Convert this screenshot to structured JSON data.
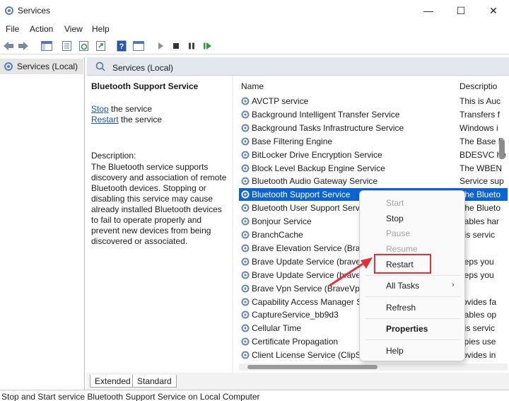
{
  "window": {
    "title": "Services",
    "minimize": "—",
    "maximize": "☐",
    "close": "✕"
  },
  "menu": [
    "File",
    "Action",
    "View",
    "Help"
  ],
  "toolbar": [
    "back-icon",
    "forward-icon",
    "console-tree-icon",
    "properties-icon",
    "refresh-icon",
    "export-icon",
    "help-icon",
    "view-icon",
    "start-icon",
    "stop-icon",
    "pause-icon",
    "restart-icon"
  ],
  "tree": {
    "label": "Services (Local)"
  },
  "right_header": {
    "label": "Services (Local)"
  },
  "details": {
    "title": "Bluetooth Support Service",
    "stop_link": "Stop",
    "stop_suffix": " the service",
    "restart_link": "Restart",
    "restart_suffix": " the service",
    "description_label": "Description:",
    "description": "The Bluetooth service supports discovery and association of remote Bluetooth devices.  Stopping or disabling this service may cause already installed Bluetooth devices to fail to operate properly and prevent new devices from being discovered or associated."
  },
  "columns": {
    "name": "Name",
    "description": "Descriptio"
  },
  "services": [
    {
      "name": "AVCTP service",
      "desc": "This is Auc"
    },
    {
      "name": "Background Intelligent Transfer Service",
      "desc": "Transfers f"
    },
    {
      "name": "Background Tasks Infrastructure Service",
      "desc": "Windows i"
    },
    {
      "name": "Base Filtering Engine",
      "desc": "The Base F"
    },
    {
      "name": "BitLocker Drive Encryption Service",
      "desc": "BDESVC he"
    },
    {
      "name": "Block Level Backup Engine Service",
      "desc": "The WBEN"
    },
    {
      "name": "Bluetooth Audio Gateway Service",
      "desc": "Service sup"
    },
    {
      "name": "Bluetooth Support Service",
      "desc": "The Blueto"
    },
    {
      "name": "Bluetooth User Support Servic",
      "desc": "The Blueto"
    },
    {
      "name": "Bonjour Service",
      "desc": "nables har"
    },
    {
      "name": "BranchCache",
      "desc": "his servic"
    },
    {
      "name": "Brave Elevation Service (Brave",
      "desc": ""
    },
    {
      "name": "Brave Update Service (brave)",
      "desc": "eeps you"
    },
    {
      "name": "Brave Update Service (bravem",
      "desc": "eeps you"
    },
    {
      "name": "Brave Vpn Service (BraveVpnS",
      "desc": ""
    },
    {
      "name": "Capability Access Manager Se",
      "desc": "rovides fa"
    },
    {
      "name": "CaptureService_bb9d3",
      "desc": "nables op"
    },
    {
      "name": "Cellular Time",
      "desc": "his servic"
    },
    {
      "name": "Certificate Propagation",
      "desc": "opies use"
    },
    {
      "name": "Client License Service (ClipSVC",
      "desc": "rovides in"
    }
  ],
  "context_menu": {
    "start": "Start",
    "stop": "Stop",
    "pause": "Pause",
    "resume": "Resume",
    "restart": "Restart",
    "all_tasks": "All Tasks",
    "refresh": "Refresh",
    "properties": "Properties",
    "help": "Help",
    "submenu_arrow": "›"
  },
  "tabs": [
    "Extended",
    "Standard"
  ],
  "status": "Stop and Start service Bluetooth Support Service on Local Computer",
  "colors": {
    "selection": "#0a64d6",
    "highlight": "#e0323e",
    "link": "#1a55b0"
  }
}
